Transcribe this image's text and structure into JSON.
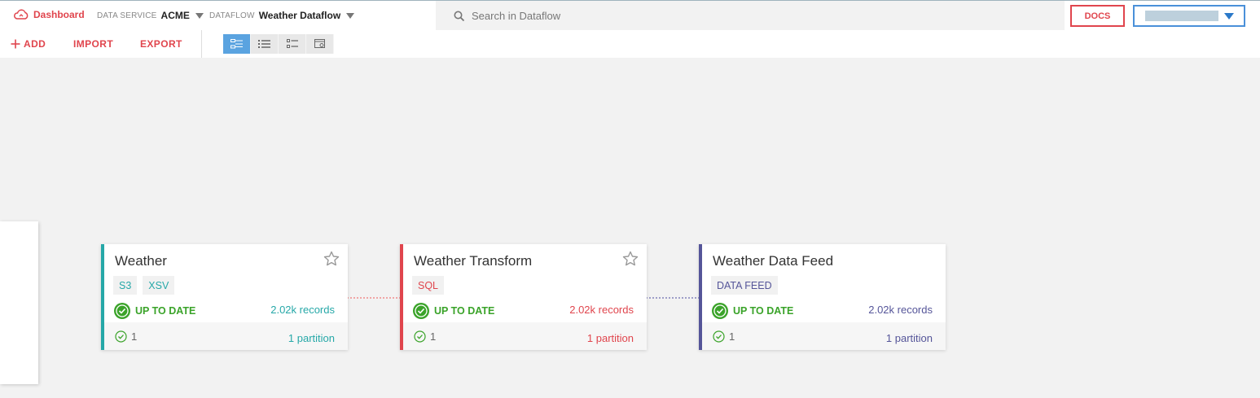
{
  "topbar": {
    "brand_label": "Dashboard",
    "data_service": {
      "label": "DATA SERVICE",
      "value": "ACME"
    },
    "dataflow": {
      "label": "DATAFLOW",
      "value": "Weather Dataflow"
    },
    "search_placeholder": "Search in Dataflow",
    "docs_label": "DOCS"
  },
  "toolbar": {
    "add_label": "ADD",
    "import_label": "IMPORT",
    "export_label": "EXPORT",
    "active_view": "graph-view"
  },
  "colors": {
    "accent": "#e0454d",
    "teal": "#26a8a8",
    "red": "#e0454d",
    "indigo": "#555599",
    "success": "#3aa329"
  },
  "cards": [
    {
      "title": "Weather",
      "tags": [
        "S3",
        "XSV"
      ],
      "status": "UP TO DATE",
      "records": "2.02k records",
      "check_count": "1",
      "partitions": "1 partition",
      "color": "#26a8a8",
      "starred": false
    },
    {
      "title": "Weather Transform",
      "tags": [
        "SQL"
      ],
      "status": "UP TO DATE",
      "records": "2.02k records",
      "check_count": "1",
      "partitions": "1 partition",
      "color": "#e0454d",
      "starred": false
    },
    {
      "title": "Weather Data Feed",
      "tags": [
        "DATA FEED"
      ],
      "status": "UP TO DATE",
      "records": "2.02k records",
      "check_count": "1",
      "partitions": "1 partition",
      "color": "#555599",
      "starred": false
    }
  ]
}
